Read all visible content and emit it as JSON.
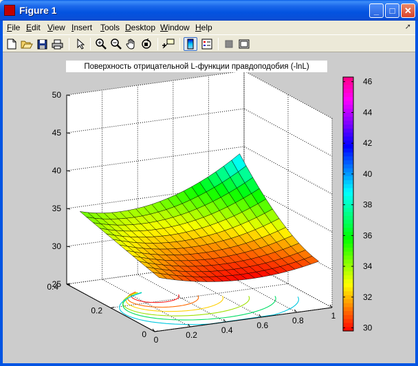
{
  "window": {
    "title": "Figure 1"
  },
  "menu": {
    "items": [
      {
        "label": "File",
        "mnemonic": "F",
        "rest": "ile"
      },
      {
        "label": "Edit",
        "mnemonic": "E",
        "rest": "dit"
      },
      {
        "label": "View",
        "mnemonic": "V",
        "rest": "iew"
      },
      {
        "label": "Insert",
        "mnemonic": "I",
        "rest": "nsert"
      },
      {
        "label": "Tools",
        "mnemonic": "T",
        "rest": "ools"
      },
      {
        "label": "Desktop",
        "mnemonic": "D",
        "rest": "esktop"
      },
      {
        "label": "Window",
        "mnemonic": "W",
        "rest": "indow"
      },
      {
        "label": "Help",
        "mnemonic": "H",
        "rest": "elp"
      }
    ]
  },
  "toolbar": {
    "icons": [
      "new-file-icon",
      "open-file-icon",
      "save-icon",
      "print-icon",
      "select-arrow-icon",
      "zoom-in-icon",
      "zoom-out-icon",
      "pan-hand-icon",
      "rotate-3d-icon",
      "data-cursor-icon",
      "colorbar-icon",
      "legend-icon",
      "hide-plot-tools-icon",
      "show-plot-tools-icon"
    ]
  },
  "chart_data": {
    "type": "surface",
    "title": "Поверхность отрицательной L-функции правдоподобия (-lnL)",
    "x_ticks": [
      "0",
      "0.2",
      "0.4",
      "0.6",
      "0.8",
      "1"
    ],
    "y_ticks": [
      "0",
      "0.2",
      "0.4"
    ],
    "z_ticks": [
      "25",
      "30",
      "35",
      "40",
      "45",
      "50"
    ],
    "xlim": [
      0,
      1
    ],
    "ylim": [
      0,
      0.4
    ],
    "zlim": [
      25,
      50
    ],
    "colorbar": {
      "ticks": [
        "30",
        "32",
        "34",
        "36",
        "38",
        "40",
        "42",
        "44",
        "46"
      ],
      "range": [
        29.8,
        46.3
      ],
      "colormap": "hsv"
    },
    "grid": true,
    "contours_on_floor": true
  }
}
